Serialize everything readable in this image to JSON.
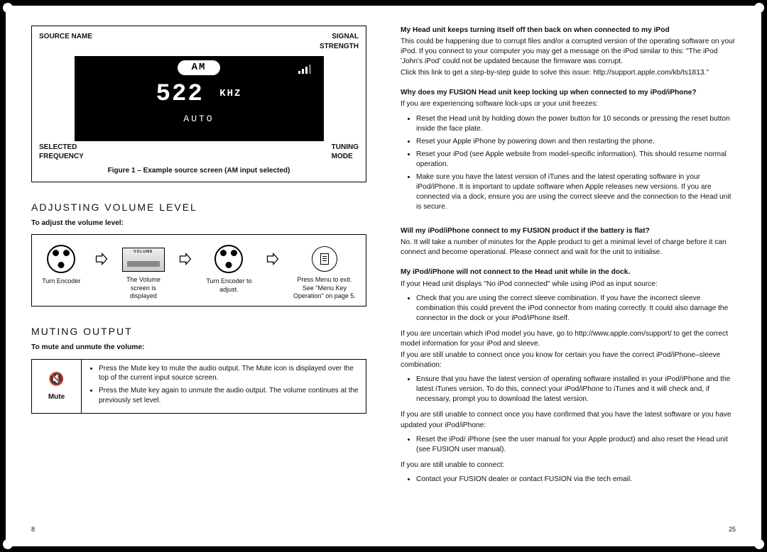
{
  "page_left_number": "8",
  "page_right_number": "25",
  "figure1": {
    "caption": "Figure 1 – Example source screen (AM input selected)",
    "labels": {
      "source_name": "SOURCE NAME",
      "signal_strength_1": "SIGNAL",
      "signal_strength_2": "STRENGTH",
      "selected_freq_1": "SELECTED",
      "selected_freq_2": "FREQUENCY",
      "tuning_mode_1": "TUNING",
      "tuning_mode_2": "MODE"
    },
    "screen": {
      "band": "AM",
      "frequency": "522",
      "unit": "KHZ",
      "mode": "AUTO"
    }
  },
  "sections": {
    "adjust_title": "ADJUSTING VOLUME LEVEL",
    "adjust_sub": "To adjust the volume level:",
    "mute_title": "MUTING OUTPUT",
    "mute_sub": "To mute and unmute the volume:"
  },
  "volume_steps": {
    "s1": "Turn Encoder",
    "s2a": "The Volume",
    "s2b": "screen is",
    "s2c": "displayed",
    "s2_screen_label": "VOLUME",
    "s3a": "Turn Encoder to",
    "s3b": "adjust.",
    "s4a": "Press Menu to exit.",
    "s4b": "See \"Menu Key",
    "s4c": "Operation\" on page 5."
  },
  "mute": {
    "label": "Mute",
    "bullet1": "Press the Mute key to mute the audio output. The Mute icon is displayed over the top of the current input source screen.",
    "bullet2": "Press the Mute key again to unmute the audio output. The volume continues at the previously set level."
  },
  "faq": {
    "q1": "My Head unit keeps turning itself off then back on when connected to my iPod",
    "a1a": "This could be happening due to corrupt files and/or a corrupted version of the operating software on your iPod. If you connect to your computer you may get a message on the iPod similar to this: \"The iPod 'John's iPod' could not be updated because the firmware was corrupt.",
    "a1b": "Click this link to get a step-by-step guide to solve this issue: http://support.apple.com/kb/ts1813.\"",
    "q2": "Why does my FUSION Head unit keep locking up when connected to my iPod/iPhone?",
    "a2intro": "If you are experiencing software lock-ups or your unit freezes:",
    "a2b1": "Reset the Head unit by holding down the power button for 10 seconds or pressing the reset button inside the face plate.",
    "a2b2": "Reset your Apple iPhone by powering down and then restarting the phone.",
    "a2b3": "Reset your iPod (see Apple website from model-specific information). This should resume normal operation.",
    "a2b4": "Make sure you have the latest version of iTunes and the latest operating software in your iPod/iPhone. It is important to update software when Apple releases new versions. If you are connected via a dock, ensure you are using the correct sleeve and the connection to the Head unit is secure.",
    "q3": "Will my iPod/iPhone connect to my FUSION product if the battery is flat?",
    "a3": "No. It will take a number of minutes for the Apple product to get a minimal level of charge before it can connect and become operational. Please connect and wait for the unit to initialise.",
    "q4": "My iPod/iPhone will not connect to the Head unit while in the dock.",
    "a4intro": "If your Head unit displays \"No iPod connected\" while using iPod as input source:",
    "a4b1": "Check that you are using the correct sleeve combination. If you have the incorrect sleeve combination this could prevent the iPod connector from mating correctly. It could also damage the connector in the dock or your iPod/iPhone itself.",
    "a4p2": "If you are uncertain which iPod model you have, go to http://www.apple.com/support/ to get the correct model information for your iPod and sleeve.",
    "a4p3": "If you are still unable to connect once you know for certain you have the correct iPod/iPhone–sleeve combination:",
    "a4b2": "Ensure that you have the latest version of operating software installed in your iPod/iPhone and the latest iTunes version. To do this, connect your iPod/iPhone to iTunes and it will check and, if necessary, prompt you to download the latest version.",
    "a4p4": "If you are still unable to connect once you have confirmed that you have the latest software or you have updated your iPod/iPhone:",
    "a4b3": "Reset the iPod/ iPhone (see the user manual for your Apple product) and also reset the Head unit (see FUSION user manual).",
    "a4p5": "If you are still unable to connect:",
    "a4b4": "Contact your FUSION dealer or contact FUSION via the tech email."
  }
}
